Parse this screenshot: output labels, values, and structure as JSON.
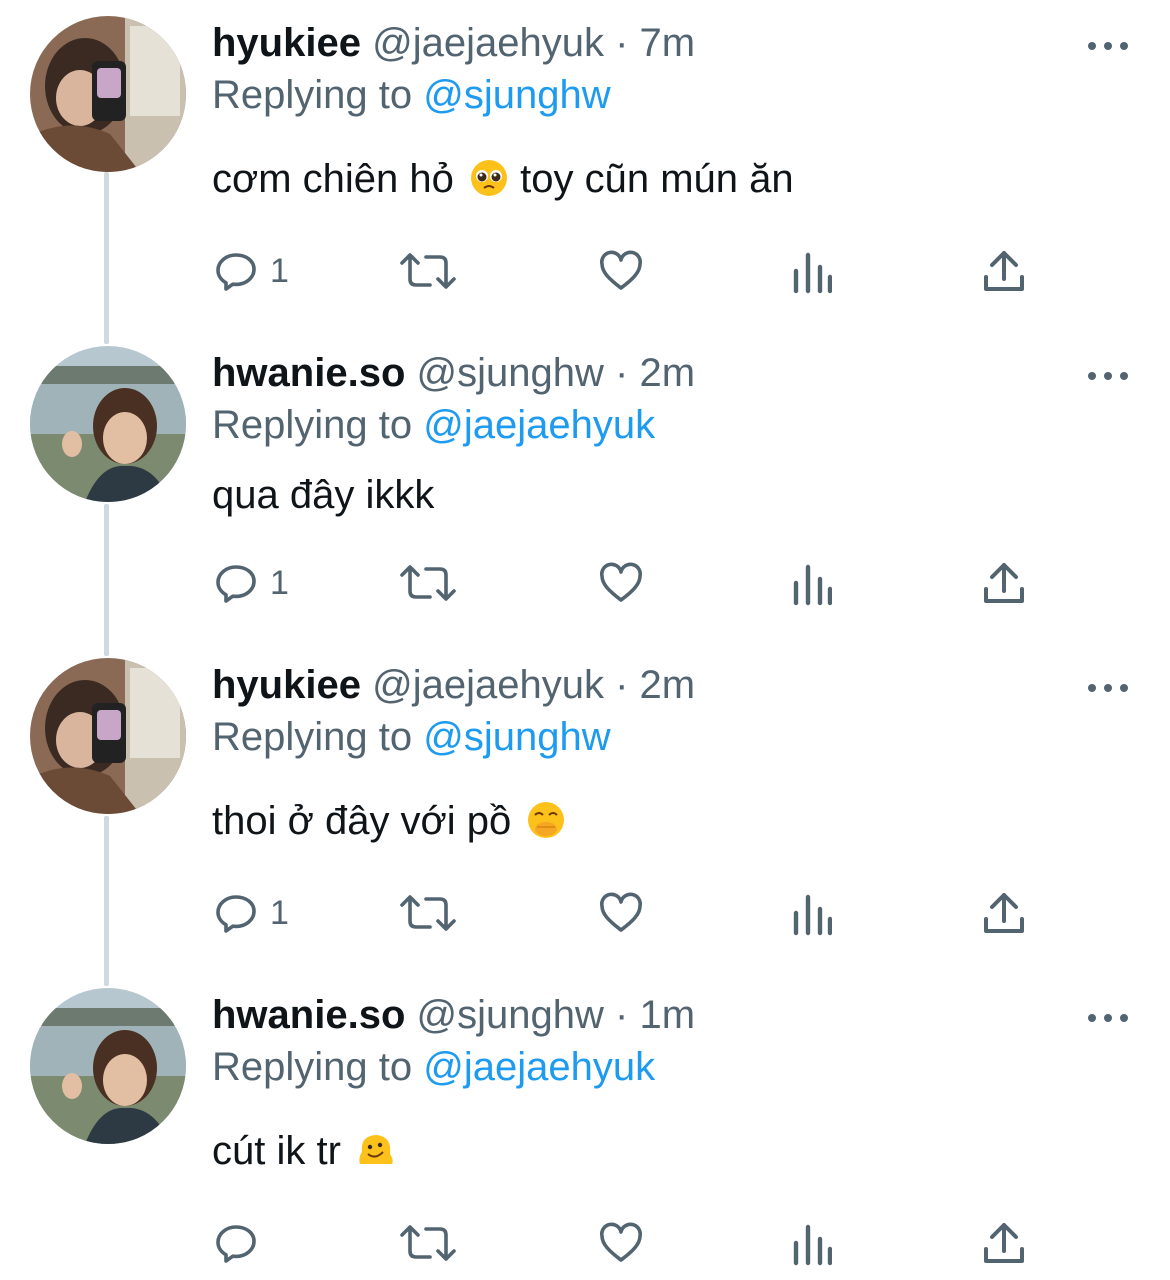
{
  "users": {
    "hyukiee": {
      "display_name": "hyukiee",
      "handle": "@jaejaehyuk"
    },
    "hwanie": {
      "display_name": "hwanie.so",
      "handle": "@sjunghw"
    }
  },
  "replying_prefix": "Replying to",
  "separator": "·",
  "tweets": [
    {
      "display_name": "hyukiee",
      "handle": "@jaejaehyuk",
      "time": "7m",
      "replying_to": "@sjunghw",
      "text": "cơm chiên hỏ",
      "emoji": "pleading-face",
      "text_after": " toy cũn mún ăn",
      "reply_count": "1"
    },
    {
      "display_name": "hwanie.so",
      "handle": "@sjunghw",
      "time": "2m",
      "replying_to": "@jaejaehyuk",
      "text": "qua đây ikkk",
      "emoji": "",
      "text_after": "",
      "reply_count": "1"
    },
    {
      "display_name": "hyukiee",
      "handle": "@jaejaehyuk",
      "time": "2m",
      "replying_to": "@sjunghw",
      "text": "thoi ở đây với pồ",
      "emoji": "face-with-hand-over-mouth",
      "text_after": "",
      "reply_count": "1"
    },
    {
      "display_name": "hwanie.so",
      "handle": "@sjunghw",
      "time": "1m",
      "replying_to": "@jaejaehyuk",
      "text": "cút ik tr",
      "emoji": "melting-face",
      "text_after": "",
      "reply_count": ""
    }
  ],
  "icons": {
    "reply": "reply-icon",
    "retweet": "retweet-icon",
    "like": "like-icon",
    "views": "views-icon",
    "share": "share-icon",
    "more": "more-icon"
  },
  "colors": {
    "text": "#0f1419",
    "secondary": "#536471",
    "link": "#1d9bf0",
    "thread_line": "#cfd9de"
  }
}
